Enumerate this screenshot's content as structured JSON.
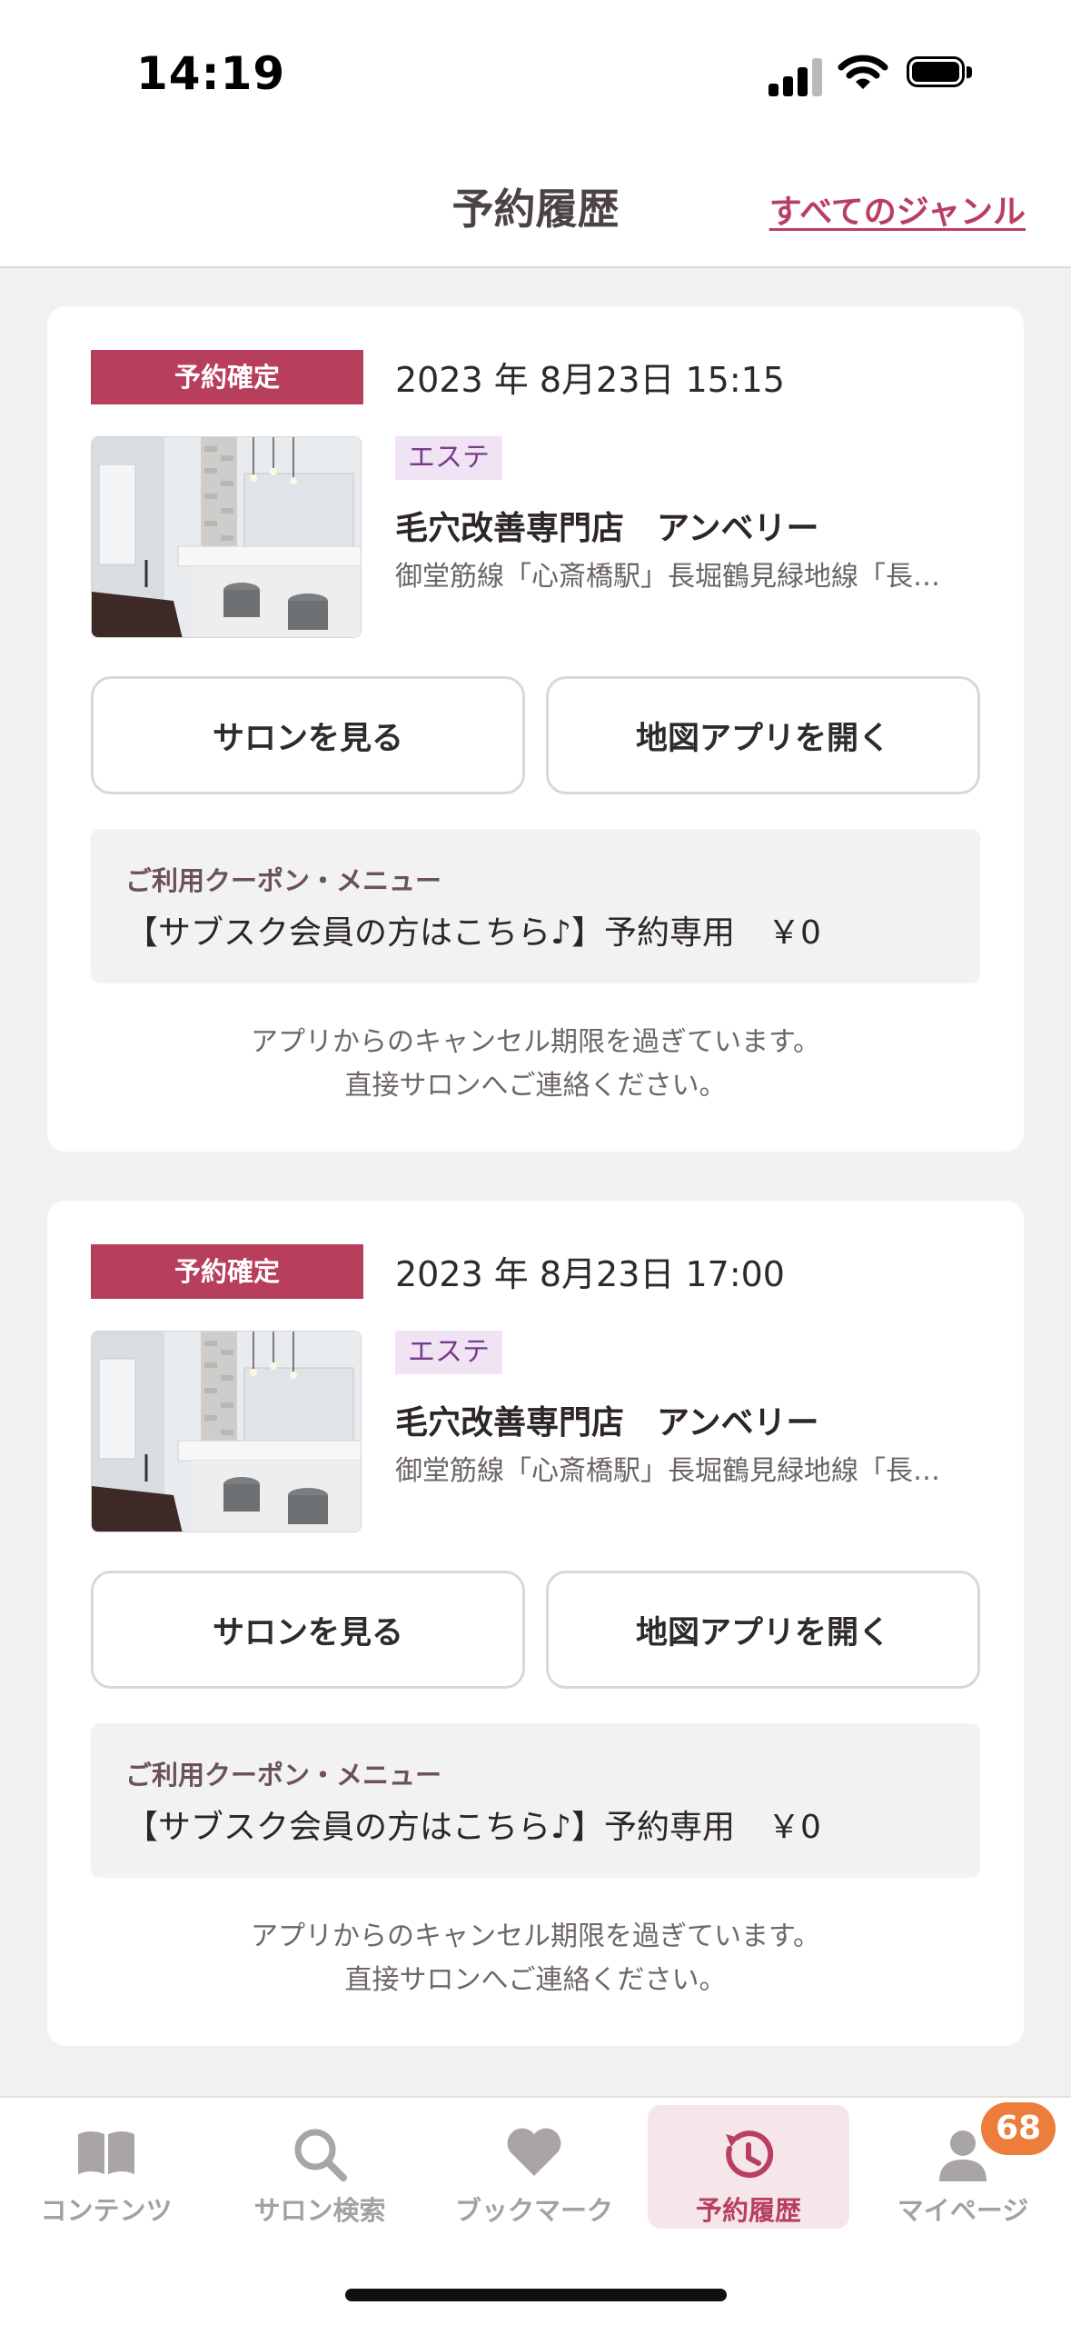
{
  "status_bar": {
    "time": "14:19"
  },
  "header": {
    "title": "予約履歴",
    "genre_link": "すべてのジャンル"
  },
  "reservations": [
    {
      "status": "予約確定",
      "datetime": "2023 年 8月23日 15:15",
      "genre": "エステ",
      "salon_name": "毛穴改善専門店　アンベリー",
      "access": "御堂筋線「心斎橋駅」長堀鶴見緑地線「長…",
      "view_salon_button": "サロンを見る",
      "map_button": "地図アプリを開く",
      "coupon_label": "ご利用クーポン・メニュー",
      "coupon_value": "【サブスク会員の方はこちら♪】予約専用　￥0",
      "note_line1": "アプリからのキャンセル期限を過ぎています。",
      "note_line2": "直接サロンへご連絡ください。"
    },
    {
      "status": "予約確定",
      "datetime": "2023 年 8月23日 17:00",
      "genre": "エステ",
      "salon_name": "毛穴改善専門店　アンベリー",
      "access": "御堂筋線「心斎橋駅」長堀鶴見緑地線「長…",
      "view_salon_button": "サロンを見る",
      "map_button": "地図アプリを開く",
      "coupon_label": "ご利用クーポン・メニュー",
      "coupon_value": "【サブスク会員の方はこちら♪】予約専用　￥0",
      "note_line1": "アプリからのキャンセル期限を過ぎています。",
      "note_line2": "直接サロンへご連絡ください。"
    }
  ],
  "tab_bar": {
    "items": [
      {
        "label": "コンテンツ",
        "icon": "book-icon"
      },
      {
        "label": "サロン検索",
        "icon": "search-icon"
      },
      {
        "label": "ブックマーク",
        "icon": "heart-icon"
      },
      {
        "label": "予約履歴",
        "icon": "history-clock-icon",
        "active": true
      },
      {
        "label": "マイページ",
        "icon": "person-icon"
      }
    ],
    "mypage_badge": "68"
  },
  "colors": {
    "accent": "#b83f61",
    "badge_orange": "#ec7d3a",
    "genre_tag_bg": "#efe3f4",
    "background": "#f2f1f0"
  }
}
